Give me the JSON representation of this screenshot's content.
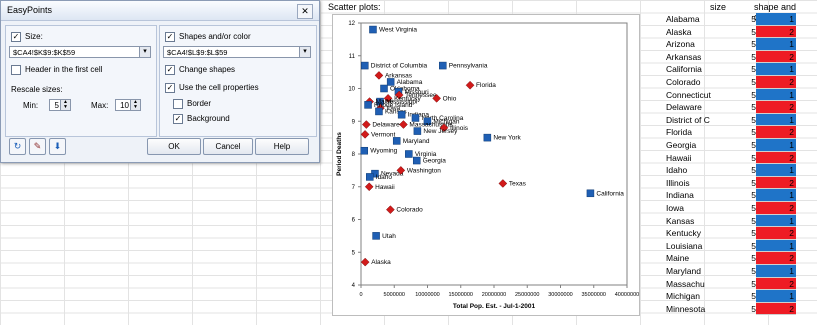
{
  "sheet": {
    "chart_heading": "Scatter plots:",
    "col_size": "size",
    "col_shape": "shape and color",
    "rows": [
      {
        "state": "Alabama",
        "size": "5",
        "shape": "1",
        "color": "#1f74c8"
      },
      {
        "state": "Alaska",
        "size": "5",
        "shape": "2",
        "color": "#ee1c25"
      },
      {
        "state": "Arizona",
        "size": "5",
        "shape": "1",
        "color": "#1f74c8"
      },
      {
        "state": "Arkansas",
        "size": "5",
        "shape": "2",
        "color": "#ee1c25"
      },
      {
        "state": "California",
        "size": "5",
        "shape": "1",
        "color": "#1f74c8"
      },
      {
        "state": "Colorado",
        "size": "5",
        "shape": "2",
        "color": "#ee1c25"
      },
      {
        "state": "Connecticut",
        "size": "5",
        "shape": "1",
        "color": "#1f74c8"
      },
      {
        "state": "Delaware",
        "size": "5",
        "shape": "2",
        "color": "#ee1c25"
      },
      {
        "state": "District of C",
        "size": "5",
        "shape": "1",
        "color": "#1f74c8"
      },
      {
        "state": "Florida",
        "size": "5",
        "shape": "2",
        "color": "#ee1c25"
      },
      {
        "state": "Georgia",
        "size": "5",
        "shape": "1",
        "color": "#1f74c8"
      },
      {
        "state": "Hawaii",
        "size": "5",
        "shape": "2",
        "color": "#ee1c25"
      },
      {
        "state": "Idaho",
        "size": "5",
        "shape": "1",
        "color": "#1f74c8"
      },
      {
        "state": "Illinois",
        "size": "5",
        "shape": "2",
        "color": "#ee1c25"
      },
      {
        "state": "Indiana",
        "size": "5",
        "shape": "1",
        "color": "#1f74c8"
      },
      {
        "state": "Iowa",
        "size": "5",
        "shape": "2",
        "color": "#ee1c25"
      },
      {
        "state": "Kansas",
        "size": "5",
        "shape": "1",
        "color": "#1f74c8"
      },
      {
        "state": "Kentucky",
        "size": "5",
        "shape": "2",
        "color": "#ee1c25"
      },
      {
        "state": "Louisiana",
        "size": "5",
        "shape": "1",
        "color": "#1f74c8"
      },
      {
        "state": "Maine",
        "size": "5",
        "shape": "2",
        "color": "#ee1c25"
      },
      {
        "state": "Maryland",
        "size": "5",
        "shape": "1",
        "color": "#1f74c8"
      },
      {
        "state": "Massachu",
        "size": "5",
        "shape": "2",
        "color": "#ee1c25"
      },
      {
        "state": "Michigan",
        "size": "5",
        "shape": "1",
        "color": "#1f74c8"
      },
      {
        "state": "Minnesota",
        "size": "5",
        "shape": "2",
        "color": "#ee1c25"
      }
    ]
  },
  "dialog": {
    "title": "EasyPoints",
    "close": "✕",
    "size_label": "Size:",
    "size_checked": true,
    "size_range": "$CA4!$K$9:$K$59",
    "shapes_label": "Shapes and/or color",
    "shapes_checked": true,
    "shapes_range": "$CA4!$L$9:$L$59",
    "header_label": "Header in the first cell",
    "header_checked": false,
    "change_shapes_label": "Change shapes",
    "change_shapes_checked": true,
    "rescale_label": "Rescale sizes:",
    "min_label": "Min:",
    "min_value": "5",
    "max_label": "Max:",
    "max_value": "10",
    "use_cell_label": "Use the cell properties",
    "use_cell_checked": true,
    "border_label": "Border",
    "border_checked": false,
    "background_label": "Background",
    "background_checked": true,
    "ok": "OK",
    "cancel": "Cancel",
    "help": "Help",
    "range_btn": "▾",
    "check_glyph": "✓"
  },
  "chart_data": {
    "type": "scatter",
    "title": "",
    "xlabel": "Total Pop. Est. - Jul-1-2001",
    "ylabel": "Period Deaths",
    "xlim": [
      0,
      40000000
    ],
    "ylim": [
      4,
      12
    ],
    "grid": false,
    "x_ticks": [
      "0",
      "5000000",
      "10000000",
      "15000000",
      "20000000",
      "25000000",
      "30000000",
      "35000000",
      "40000000"
    ],
    "y_ticks": [
      "4",
      "5",
      "6",
      "7",
      "8",
      "9",
      "10",
      "11",
      "12"
    ],
    "colors": {
      "square": "#1f5fb4",
      "diamond": "#d11a1a"
    },
    "points": [
      {
        "label": "West Virginia",
        "x": 1800000,
        "y": 11.8,
        "shape": "square"
      },
      {
        "label": "District of Columbia",
        "x": 570000,
        "y": 10.7,
        "shape": "square"
      },
      {
        "label": "Pennsylvania",
        "x": 12300000,
        "y": 10.7,
        "shape": "square"
      },
      {
        "label": "Arkansas",
        "x": 2700000,
        "y": 10.4,
        "shape": "diamond"
      },
      {
        "label": "Alabama",
        "x": 4460000,
        "y": 10.2,
        "shape": "square"
      },
      {
        "label": "Oklahoma",
        "x": 3460000,
        "y": 10.0,
        "shape": "square"
      },
      {
        "label": "Florida",
        "x": 16400000,
        "y": 10.1,
        "shape": "diamond"
      },
      {
        "label": "Missouri",
        "x": 5630000,
        "y": 9.9,
        "shape": "square"
      },
      {
        "label": "Tennessee",
        "x": 5740000,
        "y": 9.8,
        "shape": "diamond"
      },
      {
        "label": "Ohio",
        "x": 11370000,
        "y": 9.7,
        "shape": "diamond"
      },
      {
        "label": "Kentucky",
        "x": 4070000,
        "y": 9.7,
        "shape": "diamond"
      },
      {
        "label": "Mississippi",
        "x": 2860000,
        "y": 9.6,
        "shape": "square"
      },
      {
        "label": "Iowa",
        "x": 2920000,
        "y": 9.4,
        "shape": "diamond"
      },
      {
        "label": "Maine",
        "x": 1290000,
        "y": 9.6,
        "shape": "diamond"
      },
      {
        "label": "Rhode Island",
        "x": 1060000,
        "y": 9.5,
        "shape": "square"
      },
      {
        "label": "Kansas",
        "x": 2700000,
        "y": 9.3,
        "shape": "square"
      },
      {
        "label": "Indiana",
        "x": 6110000,
        "y": 9.2,
        "shape": "square"
      },
      {
        "label": "North Carolina",
        "x": 8190000,
        "y": 9.1,
        "shape": "square"
      },
      {
        "label": "Michigan",
        "x": 9990000,
        "y": 9.0,
        "shape": "square"
      },
      {
        "label": "Massachusetts",
        "x": 6380000,
        "y": 8.9,
        "shape": "diamond"
      },
      {
        "label": "Illinois",
        "x": 12480000,
        "y": 8.8,
        "shape": "diamond"
      },
      {
        "label": "Delaware",
        "x": 800000,
        "y": 8.9,
        "shape": "diamond"
      },
      {
        "label": "New Jersey",
        "x": 8480000,
        "y": 8.7,
        "shape": "square"
      },
      {
        "label": "Vermont",
        "x": 610000,
        "y": 8.6,
        "shape": "diamond"
      },
      {
        "label": "New York",
        "x": 19000000,
        "y": 8.5,
        "shape": "square"
      },
      {
        "label": "Maryland",
        "x": 5370000,
        "y": 8.4,
        "shape": "square"
      },
      {
        "label": "Wyoming",
        "x": 490000,
        "y": 8.1,
        "shape": "square"
      },
      {
        "label": "Virginia",
        "x": 7190000,
        "y": 8.0,
        "shape": "square"
      },
      {
        "label": "Nevada",
        "x": 2100000,
        "y": 7.4,
        "shape": "square"
      },
      {
        "label": "Georgia",
        "x": 8380000,
        "y": 7.8,
        "shape": "square"
      },
      {
        "label": "Washington",
        "x": 5990000,
        "y": 7.5,
        "shape": "diamond"
      },
      {
        "label": "Idaho",
        "x": 1320000,
        "y": 7.3,
        "shape": "square"
      },
      {
        "label": "Texas",
        "x": 21330000,
        "y": 7.1,
        "shape": "diamond"
      },
      {
        "label": "Hawaii",
        "x": 1230000,
        "y": 7.0,
        "shape": "diamond"
      },
      {
        "label": "California",
        "x": 34500000,
        "y": 6.8,
        "shape": "square"
      },
      {
        "label": "Colorado",
        "x": 4420000,
        "y": 6.3,
        "shape": "diamond"
      },
      {
        "label": "Utah",
        "x": 2270000,
        "y": 5.5,
        "shape": "square"
      },
      {
        "label": "Alaska",
        "x": 630000,
        "y": 4.7,
        "shape": "diamond"
      }
    ]
  }
}
